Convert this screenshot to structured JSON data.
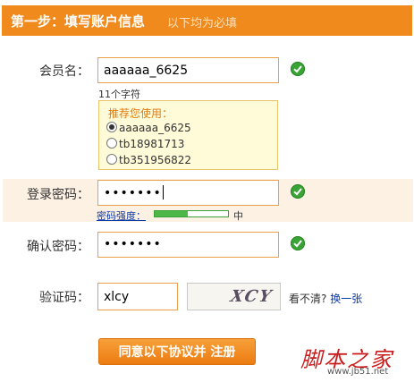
{
  "header": {
    "title": "第一步：填写账户信息",
    "subtitle": "以下均为必填"
  },
  "member": {
    "label": "会员名：",
    "value": "aaaaaa_6625",
    "char_count": "11个字符",
    "recommend_title": "推荐您使用：",
    "options": [
      "aaaaaa_6625",
      "tb18981713",
      "tb351956822"
    ],
    "selected_index": 0
  },
  "password": {
    "label": "登录密码：",
    "value": "•••••••",
    "strength_label": "密码强度：",
    "strength_value": "中",
    "strength_fraction": 0.45
  },
  "confirm": {
    "label": "确认密码：",
    "value": "•••••••"
  },
  "captcha": {
    "label": "验证码：",
    "value": "xlcy",
    "image_text": "XCY",
    "cant_see": "看不清?",
    "refresh_link": "换一张"
  },
  "submit_label": "同意以下协议并 注册",
  "watermark": {
    "name": "脚本之家",
    "url": "www.jb51.net"
  },
  "colors": {
    "accent": "#f08a1c",
    "check": "#3aa336",
    "link": "#0b3aa6"
  }
}
